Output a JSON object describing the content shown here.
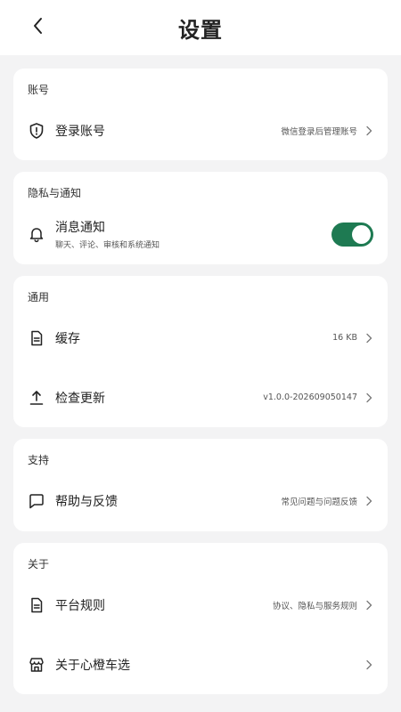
{
  "header": {
    "title": "设置"
  },
  "sections": {
    "account": {
      "title": "账号",
      "login": {
        "label": "登录账号",
        "value": "微信登录后管理账号",
        "icon": "shield-icon"
      }
    },
    "privacy": {
      "title": "隐私与通知",
      "notifications": {
        "label": "消息通知",
        "sublabel": "聊天、评论、审核和系统通知",
        "enabled": true,
        "icon": "bell-icon"
      }
    },
    "general": {
      "title": "通用",
      "cache": {
        "label": "缓存",
        "value": "16 KB",
        "icon": "document-icon"
      },
      "update": {
        "label": "检查更新",
        "value": "v1.0.0-202609050147",
        "icon": "upload-icon"
      }
    },
    "support": {
      "title": "支持",
      "help": {
        "label": "帮助与反馈",
        "value": "常见问题与问题反馈",
        "icon": "chat-icon"
      }
    },
    "about": {
      "title": "关于",
      "rules": {
        "label": "平台规则",
        "value": "协议、隐私与服务规则",
        "icon": "document-icon"
      },
      "about_app": {
        "label": "关于心橙车选",
        "value": "",
        "icon": "store-icon"
      }
    }
  },
  "colors": {
    "accent": "#1e7a52",
    "background": "#f3f3f4"
  }
}
